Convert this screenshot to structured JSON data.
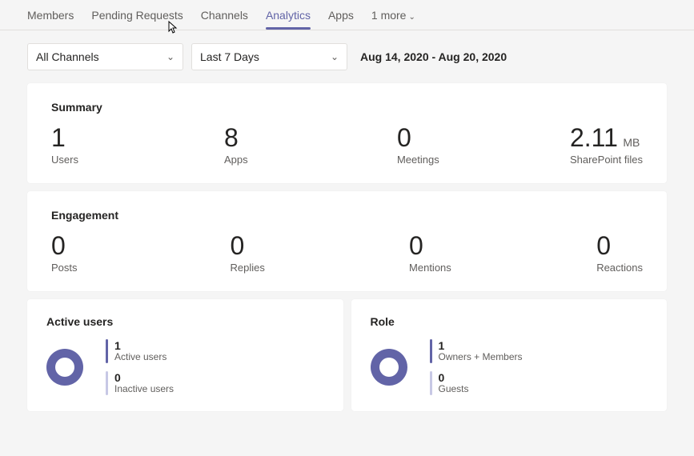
{
  "tabs": {
    "members": "Members",
    "pending": "Pending Requests",
    "channels": "Channels",
    "analytics": "Analytics",
    "apps": "Apps",
    "more": "1 more"
  },
  "filters": {
    "channel": "All Channels",
    "period": "Last 7 Days",
    "date_range": "Aug 14, 2020 - Aug 20, 2020"
  },
  "summary": {
    "title": "Summary",
    "users": {
      "value": "1",
      "label": "Users"
    },
    "apps": {
      "value": "8",
      "label": "Apps"
    },
    "meetings": {
      "value": "0",
      "label": "Meetings"
    },
    "files": {
      "value": "2.11",
      "unit": "MB",
      "label": "SharePoint files"
    }
  },
  "engagement": {
    "title": "Engagement",
    "posts": {
      "value": "0",
      "label": "Posts"
    },
    "replies": {
      "value": "0",
      "label": "Replies"
    },
    "mentions": {
      "value": "0",
      "label": "Mentions"
    },
    "reactions": {
      "value": "0",
      "label": "Reactions"
    }
  },
  "active_users": {
    "title": "Active users",
    "active": {
      "value": "1",
      "label": "Active users"
    },
    "inactive": {
      "value": "0",
      "label": "Inactive users"
    }
  },
  "role": {
    "title": "Role",
    "owners": {
      "value": "1",
      "label": "Owners + Members"
    },
    "guests": {
      "value": "0",
      "label": "Guests"
    }
  },
  "chart_data": [
    {
      "type": "pie",
      "title": "Active users",
      "categories": [
        "Active users",
        "Inactive users"
      ],
      "values": [
        1,
        0
      ]
    },
    {
      "type": "pie",
      "title": "Role",
      "categories": [
        "Owners + Members",
        "Guests"
      ],
      "values": [
        1,
        0
      ]
    }
  ]
}
